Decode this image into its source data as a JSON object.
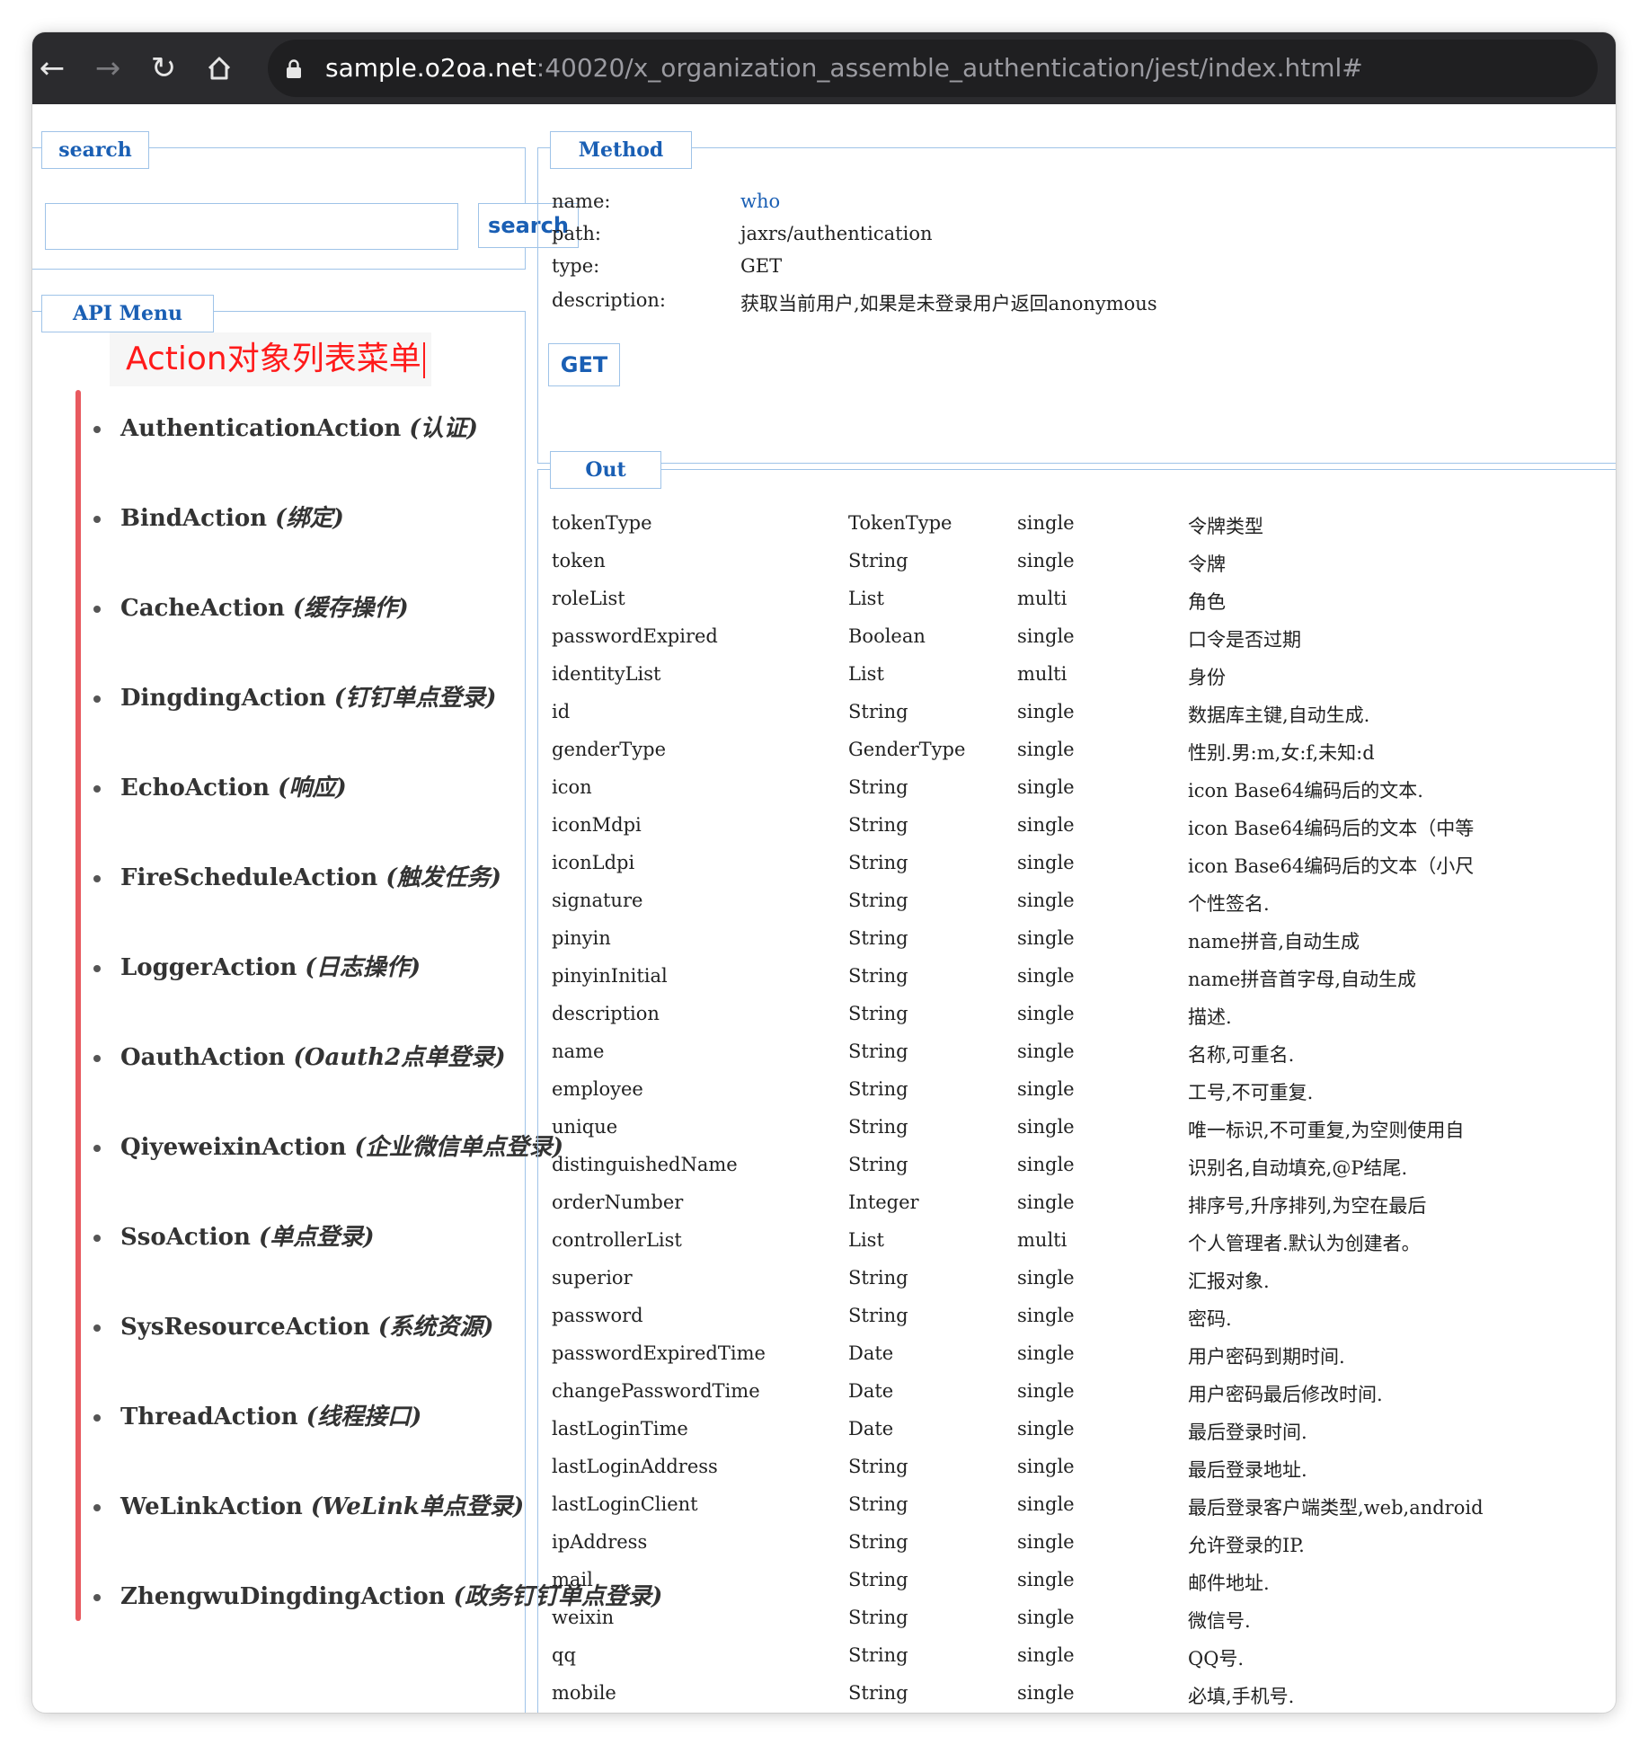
{
  "browser": {
    "url_host": "sample.o2oa.net",
    "url_rest": ":40020/x_organization_assemble_authentication/jest/index.html#"
  },
  "search": {
    "legend": "search",
    "input_value": "",
    "button_label": "search"
  },
  "api_menu": {
    "legend": "API Menu",
    "annotation": "Action对象列表菜单",
    "items": [
      {
        "name": "AuthenticationAction",
        "desc": "(认证)"
      },
      {
        "name": "BindAction",
        "desc": "(绑定)"
      },
      {
        "name": "CacheAction",
        "desc": "(缓存操作)"
      },
      {
        "name": "DingdingAction",
        "desc": "(钉钉单点登录)"
      },
      {
        "name": "EchoAction",
        "desc": "(响应)"
      },
      {
        "name": "FireScheduleAction",
        "desc": "(触发任务)"
      },
      {
        "name": "LoggerAction",
        "desc": "(日志操作)"
      },
      {
        "name": "OauthAction",
        "desc": "(Oauth2点单登录)"
      },
      {
        "name": "QiyeweixinAction",
        "desc": "(企业微信单点登录)"
      },
      {
        "name": "SsoAction",
        "desc": "(单点登录)"
      },
      {
        "name": "SysResourceAction",
        "desc": "(系统资源)"
      },
      {
        "name": "ThreadAction",
        "desc": "(线程接口)"
      },
      {
        "name": "WeLinkAction",
        "desc": "(WeLink单点登录)"
      },
      {
        "name": "ZhengwuDingdingAction",
        "desc": "(政务钉钉单点登录)"
      }
    ]
  },
  "method": {
    "legend": "Method",
    "name_label": "name:",
    "name_value": "who",
    "path_label": "path:",
    "path_value": "jaxrs/authentication",
    "type_label": "type:",
    "type_value": "GET",
    "description_label": "description:",
    "description_value": "获取当前用户,如果是未登录用户返回anonymous",
    "get_button": "GET"
  },
  "out": {
    "legend": "Out",
    "rows": [
      [
        "tokenType",
        "TokenType",
        "single",
        "令牌类型"
      ],
      [
        "token",
        "String",
        "single",
        "令牌"
      ],
      [
        "roleList",
        "List",
        "multi",
        "角色"
      ],
      [
        "passwordExpired",
        "Boolean",
        "single",
        "口令是否过期"
      ],
      [
        "identityList",
        "List",
        "multi",
        "身份"
      ],
      [
        "id",
        "String",
        "single",
        "数据库主键,自动生成."
      ],
      [
        "genderType",
        "GenderType",
        "single",
        "性别.男:m,女:f,未知:d"
      ],
      [
        "icon",
        "String",
        "single",
        "icon Base64编码后的文本."
      ],
      [
        "iconMdpi",
        "String",
        "single",
        "icon Base64编码后的文本（中等"
      ],
      [
        "iconLdpi",
        "String",
        "single",
        "icon Base64编码后的文本（小尺"
      ],
      [
        "signature",
        "String",
        "single",
        "个性签名."
      ],
      [
        "pinyin",
        "String",
        "single",
        "name拼音,自动生成"
      ],
      [
        "pinyinInitial",
        "String",
        "single",
        "name拼音首字母,自动生成"
      ],
      [
        "description",
        "String",
        "single",
        "描述."
      ],
      [
        "name",
        "String",
        "single",
        "名称,可重名."
      ],
      [
        "employee",
        "String",
        "single",
        "工号,不可重复."
      ],
      [
        "unique",
        "String",
        "single",
        "唯一标识,不可重复,为空则使用自"
      ],
      [
        "distinguishedName",
        "String",
        "single",
        "识别名,自动填充,@P结尾."
      ],
      [
        "orderNumber",
        "Integer",
        "single",
        "排序号,升序排列,为空在最后"
      ],
      [
        "controllerList",
        "List",
        "multi",
        "个人管理者.默认为创建者。"
      ],
      [
        "superior",
        "String",
        "single",
        "汇报对象."
      ],
      [
        "password",
        "String",
        "single",
        "密码."
      ],
      [
        "passwordExpiredTime",
        "Date",
        "single",
        "用户密码到期时间."
      ],
      [
        "changePasswordTime",
        "Date",
        "single",
        "用户密码最后修改时间."
      ],
      [
        "lastLoginTime",
        "Date",
        "single",
        "最后登录时间."
      ],
      [
        "lastLoginAddress",
        "String",
        "single",
        "最后登录地址."
      ],
      [
        "lastLoginClient",
        "String",
        "single",
        "最后登录客户端类型,web,android"
      ],
      [
        "ipAddress",
        "String",
        "single",
        "允许登录的IP."
      ],
      [
        "mail",
        "String",
        "single",
        "邮件地址."
      ],
      [
        "weixin",
        "String",
        "single",
        "微信号."
      ],
      [
        "qq",
        "String",
        "single",
        "QQ号."
      ],
      [
        "mobile",
        "String",
        "single",
        "必填,手机号."
      ]
    ]
  }
}
